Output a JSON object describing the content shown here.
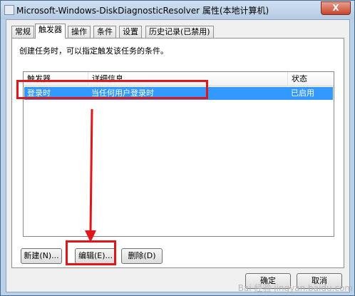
{
  "window": {
    "title": "Microsoft-Windows-DiskDiagnosticResolver 属性(本地计算机)",
    "close_label": "X"
  },
  "tabs": [
    {
      "label": "常规"
    },
    {
      "label": "触发器"
    },
    {
      "label": "操作"
    },
    {
      "label": "条件"
    },
    {
      "label": "设置"
    },
    {
      "label": "历史记录(已禁用)"
    }
  ],
  "active_tab": "触发器",
  "description": "创建任务时，可以指定触发该任务的条件。",
  "list": {
    "columns": [
      "触发器",
      "详细信息",
      "状态"
    ],
    "rows": [
      {
        "trigger": "登录时",
        "details": "当任何用户登录时",
        "status": "已启用",
        "selected": true
      }
    ]
  },
  "buttons": {
    "new": "新建(N)...",
    "edit": "编辑(E)...",
    "delete": "删除(D)",
    "ok": "确定",
    "cancel": "取消"
  },
  "watermark": "Bai 经验 jingyan.baidu.com",
  "colors": {
    "selection": "#3399ff",
    "highlight": "#e0161b"
  }
}
